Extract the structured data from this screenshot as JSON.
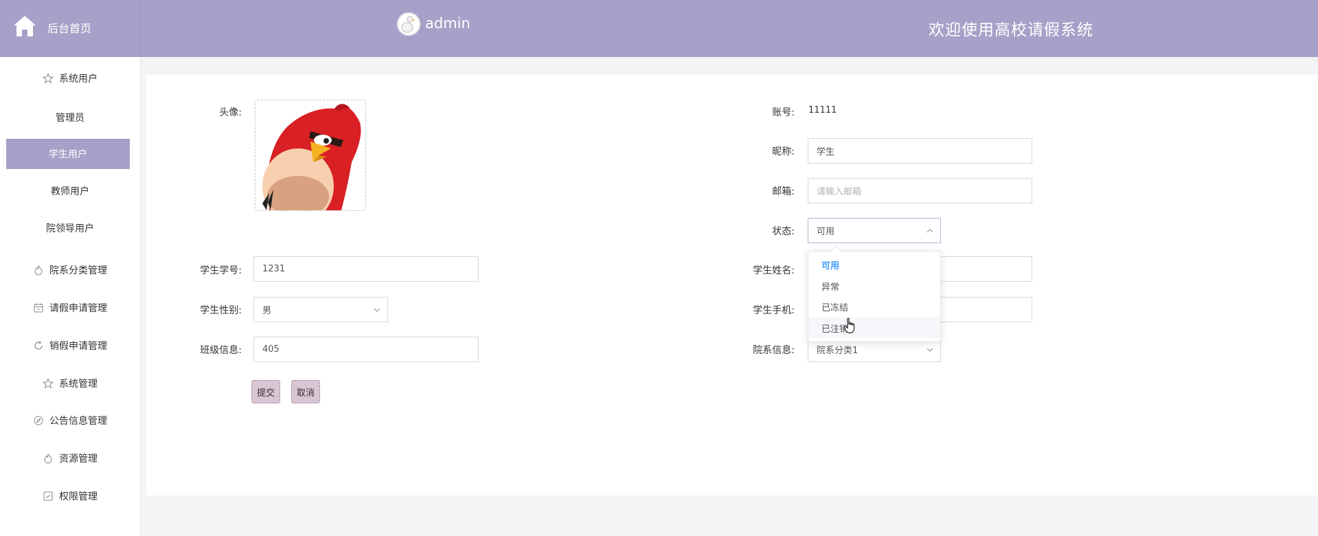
{
  "header": {
    "brand_label": "后台首页",
    "username": "admin",
    "site_title": "欢迎使用高校请假系统",
    "home_icon": "home-icon",
    "header_color": "#a8a0c8"
  },
  "sidebar": {
    "items": [
      {
        "label": "系统用户",
        "icon": "star-icon"
      },
      {
        "label": "管理员",
        "icon": ""
      },
      {
        "label": "学生用户",
        "icon": "",
        "active": true
      },
      {
        "label": "教师用户",
        "icon": ""
      },
      {
        "label": "院领导用户",
        "icon": ""
      },
      {
        "label": "院系分类管理",
        "icon": "flame-icon"
      },
      {
        "label": "请假申请管理",
        "icon": "calendar-icon"
      },
      {
        "label": "销假申请管理",
        "icon": "refresh-icon"
      },
      {
        "label": "系统管理",
        "icon": "star-icon"
      },
      {
        "label": "公告信息管理",
        "icon": "compass-icon"
      },
      {
        "label": "资源管理",
        "icon": "flame-icon"
      },
      {
        "label": "权限管理",
        "icon": "checkbox-icon"
      }
    ]
  },
  "form": {
    "avatar_label": "头像:",
    "account_label": "账号:",
    "account_value": "11111",
    "nickname_label": "昵称:",
    "nickname_value": "学生",
    "email_label": "邮箱:",
    "email_placeholder": "请输入邮箱",
    "status_label": "状态:",
    "status_value": "可用",
    "student_id_label": "学生学号:",
    "student_id_value": "1231",
    "student_name_label": "学生姓名:",
    "gender_label": "学生性别:",
    "gender_value": "男",
    "phone_label": "学生手机:",
    "class_label": "班级信息:",
    "class_value": "405",
    "department_label": "院系信息:",
    "department_value": "院系分类1",
    "submit_label": "提交",
    "cancel_label": "取消"
  },
  "status_dropdown": {
    "options": [
      "可用",
      "异常",
      "已冻结",
      "已注销"
    ],
    "selected": "可用",
    "hovered": "已注销"
  }
}
